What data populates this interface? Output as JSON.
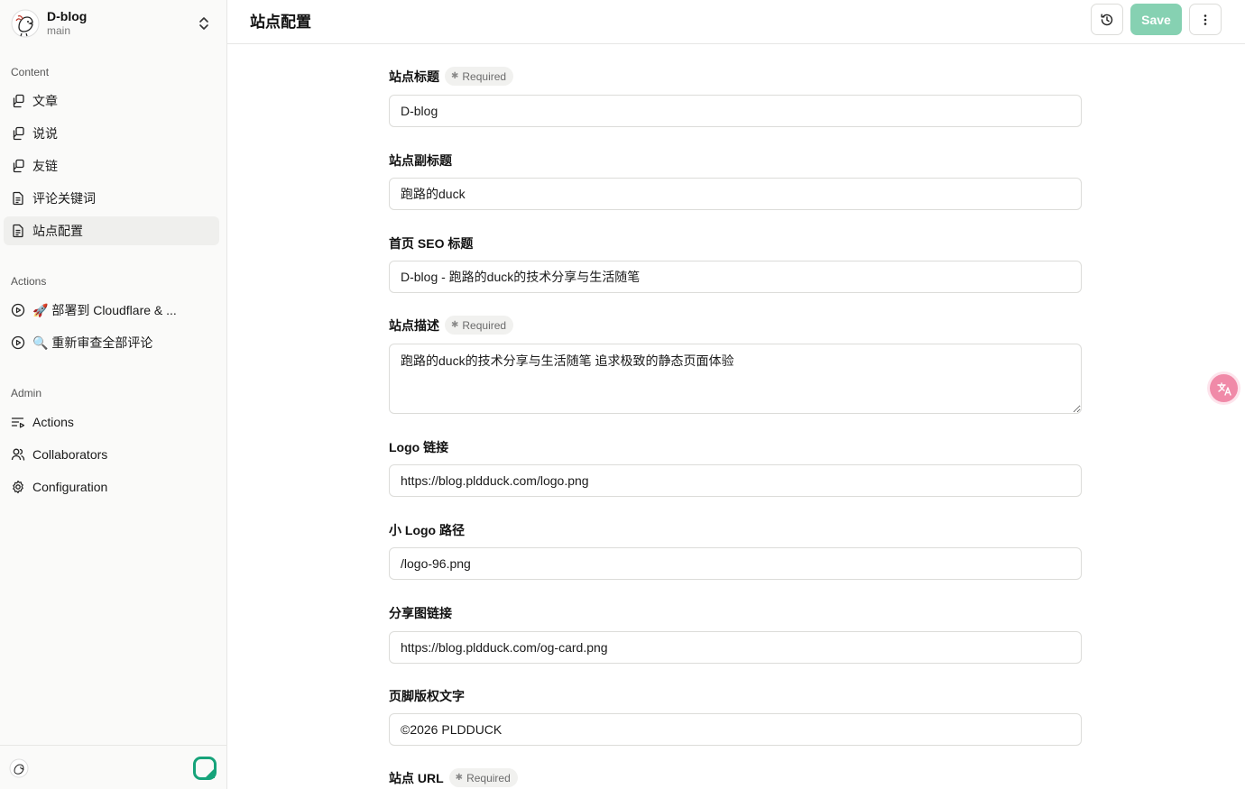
{
  "app": {
    "repo_name": "D-blog",
    "branch": "main",
    "brand_color": "#16a37a",
    "save_color": "#86d1b2"
  },
  "sidebar": {
    "content_title": "Content",
    "content_items": [
      {
        "label": "文章",
        "icon": "collection-icon"
      },
      {
        "label": "说说",
        "icon": "collection-icon"
      },
      {
        "label": "友链",
        "icon": "collection-icon"
      },
      {
        "label": "评论关键词",
        "icon": "file-icon"
      },
      {
        "label": "站点配置",
        "icon": "file-icon",
        "active": true
      }
    ],
    "actions_title": "Actions",
    "action_items": [
      {
        "label": "🚀 部署到 Cloudflare & ...",
        "icon": "play-circle-icon"
      },
      {
        "label": "🔍 重新审查全部评论",
        "icon": "play-circle-icon"
      }
    ],
    "admin_title": "Admin",
    "admin_items": [
      {
        "label": "Actions",
        "icon": "list-play-icon"
      },
      {
        "label": "Collaborators",
        "icon": "users-icon"
      },
      {
        "label": "Configuration",
        "icon": "gear-icon"
      }
    ]
  },
  "header": {
    "title": "站点配置",
    "save_label": "Save"
  },
  "form": {
    "required_label": "Required",
    "site_title": {
      "label": "站点标题",
      "value": "D-blog",
      "required": true
    },
    "site_subtitle": {
      "label": "站点副标题",
      "value": "跑路的duck"
    },
    "seo_title": {
      "label": "首页 SEO 标题",
      "value": "D-blog - 跑路的duck的技术分享与生活随笔"
    },
    "site_description": {
      "label": "站点描述",
      "value": "跑路的duck的技术分享与生活随笔 追求极致的静态页面体验",
      "required": true
    },
    "logo_url": {
      "label": "Logo 链接",
      "value": "https://blog.pldduck.com/logo.png"
    },
    "small_logo_path": {
      "label": "小 Logo 路径",
      "value": "/logo-96.png"
    },
    "share_image_url": {
      "label": "分享图链接",
      "value": "https://blog.pldduck.com/og-card.png"
    },
    "footer_copyright": {
      "label": "页脚版权文字",
      "value": "©2026 PLDDUCK"
    },
    "site_url": {
      "label": "站点 URL",
      "required": true
    }
  }
}
